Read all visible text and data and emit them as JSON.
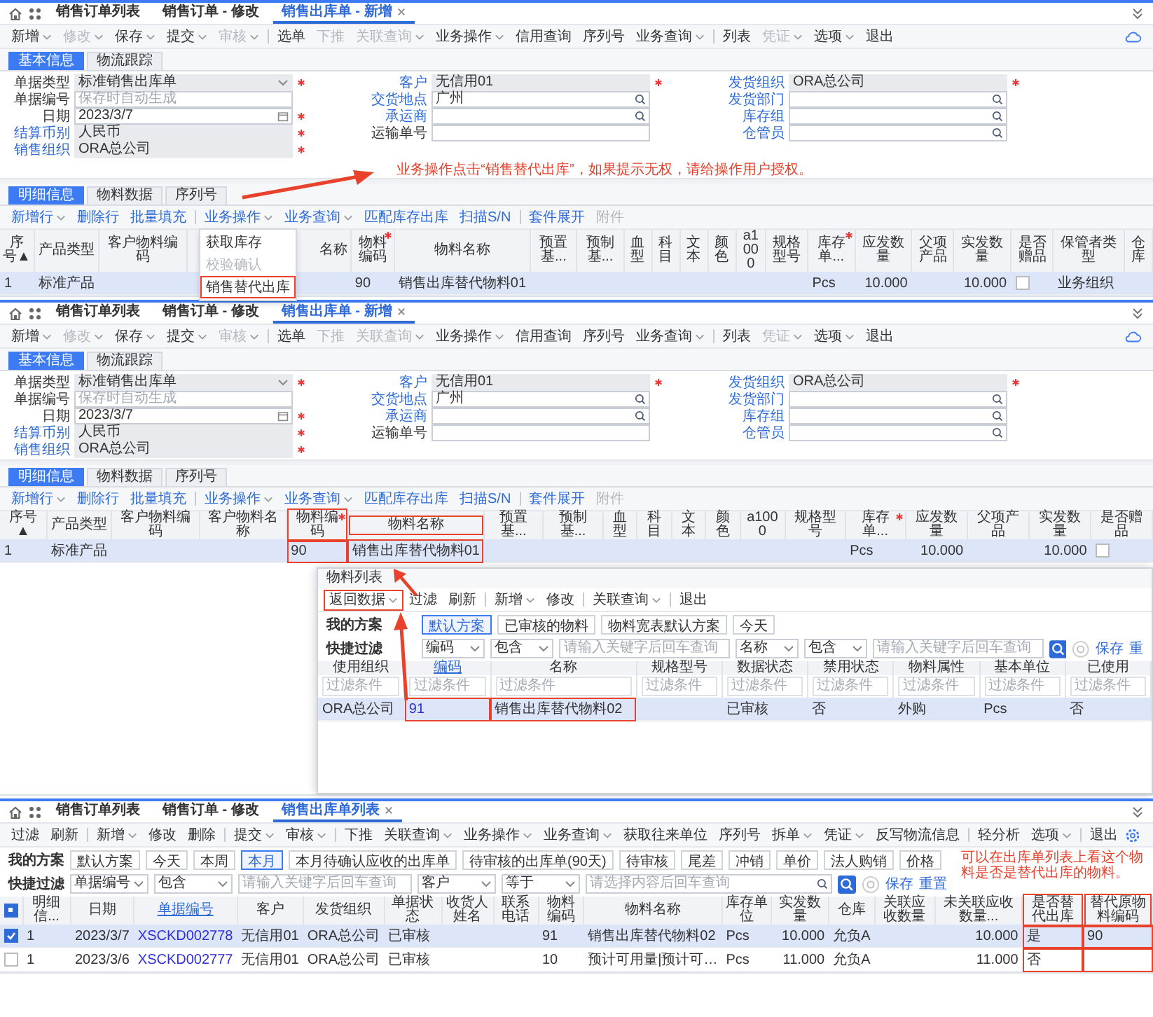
{
  "screens": [
    {
      "kind": "form",
      "tabs": [
        {
          "label": "销售订单列表",
          "selected": false
        },
        {
          "label": "销售订单 - 修改",
          "selected": false
        },
        {
          "label": "销售出库单 - 新增",
          "selected": true
        }
      ],
      "toolbar": [
        {
          "label": "新增",
          "dropdown": true,
          "disabled": false
        },
        {
          "label": "修改",
          "dropdown": true,
          "disabled": true
        },
        {
          "label": "保存",
          "dropdown": true,
          "disabled": false
        },
        {
          "label": "提交",
          "dropdown": true,
          "disabled": false
        },
        {
          "label": "审核",
          "dropdown": true,
          "disabled": true,
          "divider": true
        },
        {
          "label": "选单",
          "dropdown": false,
          "disabled": false
        },
        {
          "label": "下推",
          "dropdown": false,
          "disabled": true
        },
        {
          "label": "关联查询",
          "dropdown": true,
          "disabled": true
        },
        {
          "label": "业务操作",
          "dropdown": true,
          "disabled": false
        },
        {
          "label": "信用查询",
          "dropdown": false,
          "disabled": false
        },
        {
          "label": "序列号",
          "dropdown": false,
          "disabled": false
        },
        {
          "label": "业务查询",
          "dropdown": true,
          "disabled": false,
          "divider": true
        },
        {
          "label": "列表",
          "dropdown": false,
          "disabled": false
        },
        {
          "label": "凭证",
          "dropdown": true,
          "disabled": true
        },
        {
          "label": "选项",
          "dropdown": true,
          "disabled": false
        },
        {
          "label": "退出",
          "dropdown": false,
          "disabled": false
        }
      ],
      "form_tabs": [
        {
          "label": "基本信息",
          "selected": true
        },
        {
          "label": "物流跟踪",
          "selected": false
        }
      ],
      "fields": [
        [
          {
            "label": "单据类型",
            "link": false,
            "required": true,
            "kind": "select",
            "value": "标准销售出库单"
          },
          {
            "label": "单据编号",
            "link": false,
            "required": false,
            "kind": "text",
            "placeholder": "保存时自动生成"
          },
          {
            "label": "日期",
            "link": false,
            "required": true,
            "kind": "date",
            "value": "2023/3/7"
          },
          {
            "label": "结算币别",
            "link": true,
            "required": true,
            "kind": "readonly",
            "value": "人民币"
          },
          {
            "label": "销售组织",
            "link": true,
            "required": true,
            "kind": "readonly",
            "value": "ORA总公司"
          }
        ],
        [
          {
            "label": "客户",
            "link": true,
            "required": true,
            "kind": "readonly",
            "value": "无信用01"
          },
          {
            "label": "交货地点",
            "link": true,
            "required": false,
            "kind": "search",
            "value": "广州"
          },
          {
            "label": "承运商",
            "link": true,
            "required": false,
            "kind": "search"
          },
          {
            "label": "运输单号",
            "link": false,
            "required": false,
            "kind": "text"
          }
        ],
        [
          {
            "label": "发货组织",
            "link": true,
            "required": true,
            "kind": "readonly",
            "value": "ORA总公司"
          },
          {
            "label": "发货部门",
            "link": true,
            "required": false,
            "kind": "search"
          },
          {
            "label": "库存组",
            "link": true,
            "required": false,
            "kind": "search"
          },
          {
            "label": "仓管员",
            "link": true,
            "required": false,
            "kind": "search"
          }
        ]
      ],
      "note": "业务操作点击“销售替代出库”，如果提示无权，请给操作用户授权。",
      "detail_tabs": [
        {
          "label": "明细信息",
          "selected": true
        },
        {
          "label": "物料数据",
          "selected": false
        },
        {
          "label": "序列号",
          "selected": false
        }
      ],
      "detail_toolbar": [
        {
          "label": "新增行",
          "dropdown": true,
          "disabled": false
        },
        {
          "label": "删除行",
          "dropdown": false,
          "disabled": false
        },
        {
          "label": "批量填充",
          "dropdown": false,
          "disabled": false,
          "divider": true
        },
        {
          "label": "业务操作",
          "dropdown": true,
          "disabled": false,
          "menu": [
            {
              "label": "获取库存",
              "disabled": false,
              "highlighted": false
            },
            {
              "label": "校验确认",
              "disabled": true,
              "highlighted": false
            },
            {
              "label": "销售替代出库",
              "disabled": false,
              "highlighted": true
            }
          ]
        },
        {
          "label": "业务查询",
          "dropdown": true,
          "disabled": false
        },
        {
          "label": "匹配库存出库",
          "dropdown": false,
          "disabled": false
        },
        {
          "label": "扫描S/N",
          "dropdown": false,
          "disabled": false,
          "divider": true
        },
        {
          "label": "套件展开",
          "dropdown": false,
          "disabled": false
        },
        {
          "label": "附件",
          "dropdown": false,
          "disabled": true
        }
      ],
      "table": {
        "columns": [
          {
            "label": "序号▲"
          },
          {
            "label": "产品类型"
          },
          {
            "label": "客户物料编码"
          },
          {
            "label": "名称"
          },
          {
            "label": "物料编码",
            "required": true
          },
          {
            "label": "物料名称"
          },
          {
            "label": "预置基..."
          },
          {
            "label": "预制基..."
          },
          {
            "label": "血型"
          },
          {
            "label": "科目"
          },
          {
            "label": "文本"
          },
          {
            "label": "颜色"
          },
          {
            "label": "a1000"
          },
          {
            "label": "规格型号"
          },
          {
            "label": "库存单...",
            "required": true
          },
          {
            "label": "应发数量",
            "numeric": true
          },
          {
            "label": "父项产品"
          },
          {
            "label": "实发数量",
            "numeric": true
          },
          {
            "label": "是否赠品"
          },
          {
            "label": "保管者类型"
          },
          {
            "label": "仓库"
          }
        ],
        "rows": [
          {
            "selected": true,
            "cells": [
              "1",
              "标准产品",
              null,
              null,
              "90",
              "销售出库替代物料01",
              null,
              null,
              null,
              null,
              null,
              null,
              null,
              null,
              "Pcs",
              "10.000",
              null,
              "10.000",
              {
                "checked": false
              },
              "业务组织",
              null
            ]
          }
        ]
      }
    },
    {
      "kind": "form",
      "tabs": [
        {
          "label": "销售订单列表",
          "selected": false
        },
        {
          "label": "销售订单 - 修改",
          "selected": false
        },
        {
          "label": "销售出库单 - 新增",
          "selected": true
        }
      ],
      "toolbar": [
        {
          "label": "新增",
          "dropdown": true,
          "disabled": false
        },
        {
          "label": "修改",
          "dropdown": true,
          "disabled": true
        },
        {
          "label": "保存",
          "dropdown": true,
          "disabled": false
        },
        {
          "label": "提交",
          "dropdown": true,
          "disabled": false
        },
        {
          "label": "审核",
          "dropdown": true,
          "disabled": true,
          "divider": true
        },
        {
          "label": "选单",
          "dropdown": false,
          "disabled": false
        },
        {
          "label": "下推",
          "dropdown": false,
          "disabled": true
        },
        {
          "label": "关联查询",
          "dropdown": true,
          "disabled": true
        },
        {
          "label": "业务操作",
          "dropdown": true,
          "disabled": false
        },
        {
          "label": "信用查询",
          "dropdown": false,
          "disabled": false
        },
        {
          "label": "序列号",
          "dropdown": false,
          "disabled": false
        },
        {
          "label": "业务查询",
          "dropdown": true,
          "disabled": false,
          "divider": true
        },
        {
          "label": "列表",
          "dropdown": false,
          "disabled": false
        },
        {
          "label": "凭证",
          "dropdown": true,
          "disabled": true
        },
        {
          "label": "选项",
          "dropdown": true,
          "disabled": false
        },
        {
          "label": "退出",
          "dropdown": false,
          "disabled": false
        }
      ],
      "form_tabs": [
        {
          "label": "基本信息",
          "selected": true
        },
        {
          "label": "物流跟踪",
          "selected": false
        }
      ],
      "fields": [
        [
          {
            "label": "单据类型",
            "link": false,
            "required": true,
            "kind": "select",
            "value": "标准销售出库单"
          },
          {
            "label": "单据编号",
            "link": false,
            "required": false,
            "kind": "text",
            "placeholder": "保存时自动生成"
          },
          {
            "label": "日期",
            "link": false,
            "required": true,
            "kind": "date",
            "value": "2023/3/7"
          },
          {
            "label": "结算币别",
            "link": true,
            "required": true,
            "kind": "readonly",
            "value": "人民币"
          },
          {
            "label": "销售组织",
            "link": true,
            "required": true,
            "kind": "readonly",
            "value": "ORA总公司"
          }
        ],
        [
          {
            "label": "客户",
            "link": true,
            "required": true,
            "kind": "readonly",
            "value": "无信用01"
          },
          {
            "label": "交货地点",
            "link": true,
            "required": false,
            "kind": "search",
            "value": "广州"
          },
          {
            "label": "承运商",
            "link": true,
            "required": false,
            "kind": "search"
          },
          {
            "label": "运输单号",
            "link": false,
            "required": false,
            "kind": "text"
          }
        ],
        [
          {
            "label": "发货组织",
            "link": true,
            "required": true,
            "kind": "readonly",
            "value": "ORA总公司"
          },
          {
            "label": "发货部门",
            "link": true,
            "required": false,
            "kind": "search"
          },
          {
            "label": "库存组",
            "link": true,
            "required": false,
            "kind": "search"
          },
          {
            "label": "仓管员",
            "link": true,
            "required": false,
            "kind": "search"
          }
        ]
      ],
      "detail_tabs": [
        {
          "label": "明细信息",
          "selected": true
        },
        {
          "label": "物料数据",
          "selected": false
        },
        {
          "label": "序列号",
          "selected": false
        }
      ],
      "detail_toolbar": [
        {
          "label": "新增行",
          "dropdown": true,
          "disabled": false
        },
        {
          "label": "删除行",
          "dropdown": false,
          "disabled": false
        },
        {
          "label": "批量填充",
          "dropdown": false,
          "disabled": false,
          "divider": true
        },
        {
          "label": "业务操作",
          "dropdown": true,
          "disabled": false
        },
        {
          "label": "业务查询",
          "dropdown": true,
          "disabled": false
        },
        {
          "label": "匹配库存出库",
          "dropdown": false,
          "disabled": false
        },
        {
          "label": "扫描S/N",
          "dropdown": false,
          "disabled": false,
          "divider": true
        },
        {
          "label": "套件展开",
          "dropdown": false,
          "disabled": false
        },
        {
          "label": "附件",
          "dropdown": false,
          "disabled": true
        }
      ],
      "table": {
        "columns": [
          {
            "label": "序号▲"
          },
          {
            "label": "产品类型"
          },
          {
            "label": "客户物料编码"
          },
          {
            "label": "客户物料名称"
          },
          {
            "label": "物料编码",
            "required": true,
            "highlighted": true
          },
          {
            "label": "物料名称",
            "highlighted": true
          },
          {
            "label": "预置基..."
          },
          {
            "label": "预制基..."
          },
          {
            "label": "血型"
          },
          {
            "label": "科目"
          },
          {
            "label": "文本"
          },
          {
            "label": "颜色"
          },
          {
            "label": "a1000"
          },
          {
            "label": "规格型号"
          },
          {
            "label": "库存单...",
            "required": true
          },
          {
            "label": "应发数量",
            "numeric": true
          },
          {
            "label": "父项产品"
          },
          {
            "label": "实发数量",
            "numeric": true
          },
          {
            "label": "是否赠品"
          }
        ],
        "rows": [
          {
            "selected": true,
            "cells": [
              "1",
              "标准产品",
              null,
              null,
              {
                "text": "90",
                "highlighted": true
              },
              {
                "text": "销售出库替代物料01",
                "highlighted": true
              },
              null,
              null,
              null,
              null,
              null,
              null,
              null,
              null,
              "Pcs",
              "10.000",
              null,
              "10.000",
              {
                "checked": false
              }
            ]
          }
        ]
      },
      "dialog": {
        "title": "物料列表",
        "toolbar": [
          {
            "label": "返回数据",
            "dropdown": true,
            "disabled": false,
            "highlighted": true
          },
          {
            "label": "过滤",
            "dropdown": false,
            "disabled": false
          },
          {
            "label": "刷新",
            "dropdown": false,
            "disabled": false,
            "divider": true
          },
          {
            "label": "新增",
            "dropdown": true,
            "disabled": false
          },
          {
            "label": "修改",
            "dropdown": false,
            "disabled": false,
            "divider": true
          },
          {
            "label": "关联查询",
            "dropdown": true,
            "disabled": false,
            "divider": true
          },
          {
            "label": "退出",
            "dropdown": false,
            "disabled": false
          }
        ],
        "scheme_label": "我的方案",
        "schemes": [
          {
            "label": "默认方案",
            "selected": true
          },
          {
            "label": "已审核的物料",
            "selected": false
          },
          {
            "label": "物料宽表默认方案",
            "selected": false
          },
          {
            "label": "今天",
            "selected": false
          }
        ],
        "filter_label": "快捷过滤",
        "filters": [
          {
            "kind": "select",
            "value": "编码"
          },
          {
            "kind": "select",
            "value": "包含"
          },
          {
            "kind": "input",
            "placeholder": "请输入关键字后回车查询"
          },
          {
            "kind": "select",
            "value": "名称"
          },
          {
            "kind": "select",
            "value": "包含"
          },
          {
            "kind": "input",
            "placeholder": "请输入关键字后回车查询"
          }
        ],
        "actions": [
          "保存",
          "重"
        ],
        "table": {
          "columns": [
            {
              "label": "使用组织",
              "placeholder": "过滤条件"
            },
            {
              "label": "编码",
              "link": true,
              "placeholder": "过滤条件"
            },
            {
              "label": "名称",
              "placeholder": "过滤条件"
            },
            {
              "label": "规格型号",
              "placeholder": "过滤条件"
            },
            {
              "label": "数据状态",
              "placeholder": "过滤条件"
            },
            {
              "label": "禁用状态",
              "placeholder": "过滤条件"
            },
            {
              "label": "物料属性",
              "placeholder": "过滤条件"
            },
            {
              "label": "基本单位",
              "placeholder": "过滤条件"
            },
            {
              "label": "已使用",
              "placeholder": "过滤条件"
            }
          ],
          "rows": [
            {
              "selected": true,
              "cells": [
                "ORA总公司",
                {
                  "text": "91",
                  "highlighted": true
                },
                {
                  "text": "销售出库替代物料02",
                  "highlighted": true
                },
                null,
                "已审核",
                "否",
                "外购",
                "Pcs",
                "否"
              ]
            }
          ]
        }
      }
    },
    {
      "kind": "list",
      "tabs": [
        {
          "label": "销售订单列表",
          "selected": false
        },
        {
          "label": "销售订单 - 修改",
          "selected": false
        },
        {
          "label": "销售出库单列表",
          "selected": true
        }
      ],
      "toolbar": [
        {
          "label": "过滤",
          "dropdown": false,
          "disabled": false
        },
        {
          "label": "刷新",
          "dropdown": false,
          "disabled": false,
          "divider": true
        },
        {
          "label": "新增",
          "dropdown": true,
          "disabled": false
        },
        {
          "label": "修改",
          "dropdown": false,
          "disabled": false
        },
        {
          "label": "删除",
          "dropdown": false,
          "disabled": false,
          "divider": true
        },
        {
          "label": "提交",
          "dropdown": true,
          "disabled": false
        },
        {
          "label": "审核",
          "dropdown": true,
          "disabled": false,
          "divider": true
        },
        {
          "label": "下推",
          "dropdown": false,
          "disabled": false
        },
        {
          "label": "关联查询",
          "dropdown": true,
          "disabled": false
        },
        {
          "label": "业务操作",
          "dropdown": true,
          "disabled": false
        },
        {
          "label": "业务查询",
          "dropdown": true,
          "disabled": false
        },
        {
          "label": "获取往来单位",
          "dropdown": false,
          "disabled": false
        },
        {
          "label": "序列号",
          "dropdown": false,
          "disabled": false
        },
        {
          "label": "拆单",
          "dropdown": true,
          "disabled": false
        },
        {
          "label": "凭证",
          "dropdown": true,
          "disabled": false
        },
        {
          "label": "反写物流信息",
          "dropdown": false,
          "disabled": false,
          "divider": true
        },
        {
          "label": "轻分析",
          "dropdown": false,
          "disabled": false
        },
        {
          "label": "选项",
          "dropdown": true,
          "disabled": false,
          "divider": true
        },
        {
          "label": "退出",
          "dropdown": false,
          "disabled": false
        }
      ],
      "scheme_label": "我的方案",
      "schemes": [
        {
          "label": "默认方案",
          "selected": false
        },
        {
          "label": "今天",
          "selected": false
        },
        {
          "label": "本周",
          "selected": false
        },
        {
          "label": "本月",
          "selected": true
        },
        {
          "label": "本月待确认应收的出库单",
          "selected": false
        },
        {
          "label": "待审核的出库单(90天)",
          "selected": false
        },
        {
          "label": "待审核",
          "selected": false
        },
        {
          "label": "尾差",
          "selected": false
        },
        {
          "label": "冲销",
          "selected": false
        },
        {
          "label": "单价",
          "selected": false
        },
        {
          "label": "法人购销",
          "selected": false
        },
        {
          "label": "价格",
          "selected": false
        }
      ],
      "filter_label": "快捷过滤",
      "filters": [
        {
          "kind": "select",
          "value": "单据编号"
        },
        {
          "kind": "select",
          "value": "包含"
        },
        {
          "kind": "input",
          "placeholder": "请输入关键字后回车查询"
        },
        {
          "kind": "select",
          "value": "客户"
        },
        {
          "kind": "select",
          "value": "等于"
        },
        {
          "kind": "search",
          "placeholder": "请选择内容后回车查询"
        }
      ],
      "actions": [
        "保存",
        "重置"
      ],
      "note": "可以在出库单列表上看这个物料是否是替代出库的物料。",
      "table": {
        "columns": [
          {
            "kind": "checkbox",
            "indeterminate": true
          },
          {
            "label": "明细信..."
          },
          {
            "label": "日期"
          },
          {
            "label": "单据编号",
            "link": true
          },
          {
            "label": "客户"
          },
          {
            "label": "发货组织"
          },
          {
            "label": "单据状态"
          },
          {
            "label": "收货人姓名"
          },
          {
            "label": "联系电话"
          },
          {
            "label": "物料编码"
          },
          {
            "label": "物料名称"
          },
          {
            "label": "库存单位"
          },
          {
            "label": "实发数量",
            "numeric": true
          },
          {
            "label": "仓库"
          },
          {
            "label": "关联应收数量"
          },
          {
            "label": "未关联应收数量...",
            "numeric": true
          },
          {
            "label": "是否替代出库",
            "highlighted": true
          },
          {
            "label": "替代原物料编码",
            "highlighted": true
          }
        ],
        "rows": [
          {
            "selected": true,
            "cells": [
              {
                "checked": true
              },
              "1",
              "2023/3/7",
              "XSCKD002778",
              "无信用01",
              "ORA总公司",
              "已审核",
              null,
              null,
              "91",
              "销售出库替代物料02",
              "Pcs",
              "10.000",
              "允负A",
              null,
              "10.000",
              {
                "text": "是",
                "highlighted": true
              },
              {
                "text": "90",
                "highlighted": true
              }
            ]
          },
          {
            "selected": false,
            "cells": [
              {
                "checked": false
              },
              "1",
              "2023/3/6",
              "XSCKD002777",
              "无信用01",
              "ORA总公司",
              "已审核",
              null,
              null,
              "10",
              "预计可用量|预计可…",
              "Pcs",
              "11.000",
              "允负A",
              null,
              "11.000",
              {
                "text": "否",
                "highlighted": true
              },
              {
                "highlighted": true
              }
            ]
          }
        ]
      }
    }
  ]
}
